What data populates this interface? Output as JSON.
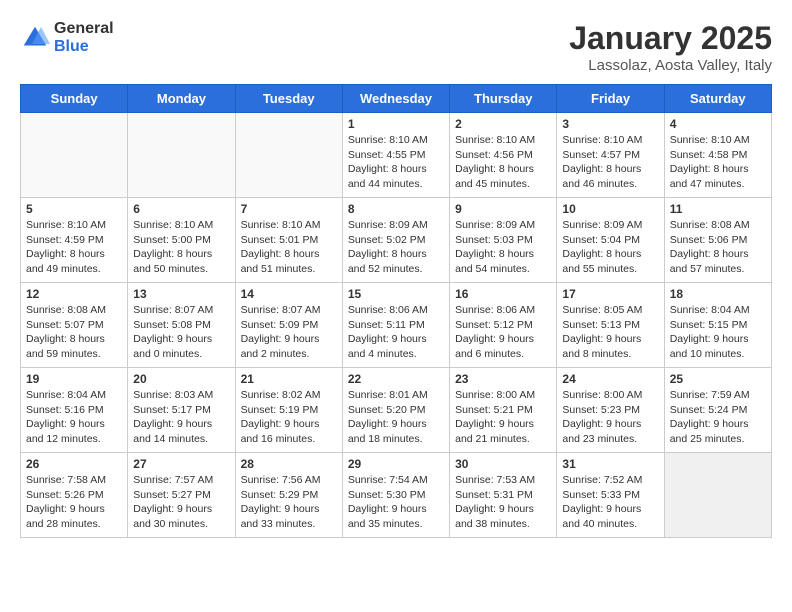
{
  "logo": {
    "general": "General",
    "blue": "Blue"
  },
  "title": "January 2025",
  "subtitle": "Lassolaz, Aosta Valley, Italy",
  "headers": [
    "Sunday",
    "Monday",
    "Tuesday",
    "Wednesday",
    "Thursday",
    "Friday",
    "Saturday"
  ],
  "weeks": [
    [
      {
        "day": "",
        "content": ""
      },
      {
        "day": "",
        "content": ""
      },
      {
        "day": "",
        "content": ""
      },
      {
        "day": "1",
        "content": "Sunrise: 8:10 AM\nSunset: 4:55 PM\nDaylight: 8 hours\nand 44 minutes."
      },
      {
        "day": "2",
        "content": "Sunrise: 8:10 AM\nSunset: 4:56 PM\nDaylight: 8 hours\nand 45 minutes."
      },
      {
        "day": "3",
        "content": "Sunrise: 8:10 AM\nSunset: 4:57 PM\nDaylight: 8 hours\nand 46 minutes."
      },
      {
        "day": "4",
        "content": "Sunrise: 8:10 AM\nSunset: 4:58 PM\nDaylight: 8 hours\nand 47 minutes."
      }
    ],
    [
      {
        "day": "5",
        "content": "Sunrise: 8:10 AM\nSunset: 4:59 PM\nDaylight: 8 hours\nand 49 minutes."
      },
      {
        "day": "6",
        "content": "Sunrise: 8:10 AM\nSunset: 5:00 PM\nDaylight: 8 hours\nand 50 minutes."
      },
      {
        "day": "7",
        "content": "Sunrise: 8:10 AM\nSunset: 5:01 PM\nDaylight: 8 hours\nand 51 minutes."
      },
      {
        "day": "8",
        "content": "Sunrise: 8:09 AM\nSunset: 5:02 PM\nDaylight: 8 hours\nand 52 minutes."
      },
      {
        "day": "9",
        "content": "Sunrise: 8:09 AM\nSunset: 5:03 PM\nDaylight: 8 hours\nand 54 minutes."
      },
      {
        "day": "10",
        "content": "Sunrise: 8:09 AM\nSunset: 5:04 PM\nDaylight: 8 hours\nand 55 minutes."
      },
      {
        "day": "11",
        "content": "Sunrise: 8:08 AM\nSunset: 5:06 PM\nDaylight: 8 hours\nand 57 minutes."
      }
    ],
    [
      {
        "day": "12",
        "content": "Sunrise: 8:08 AM\nSunset: 5:07 PM\nDaylight: 8 hours\nand 59 minutes."
      },
      {
        "day": "13",
        "content": "Sunrise: 8:07 AM\nSunset: 5:08 PM\nDaylight: 9 hours\nand 0 minutes."
      },
      {
        "day": "14",
        "content": "Sunrise: 8:07 AM\nSunset: 5:09 PM\nDaylight: 9 hours\nand 2 minutes."
      },
      {
        "day": "15",
        "content": "Sunrise: 8:06 AM\nSunset: 5:11 PM\nDaylight: 9 hours\nand 4 minutes."
      },
      {
        "day": "16",
        "content": "Sunrise: 8:06 AM\nSunset: 5:12 PM\nDaylight: 9 hours\nand 6 minutes."
      },
      {
        "day": "17",
        "content": "Sunrise: 8:05 AM\nSunset: 5:13 PM\nDaylight: 9 hours\nand 8 minutes."
      },
      {
        "day": "18",
        "content": "Sunrise: 8:04 AM\nSunset: 5:15 PM\nDaylight: 9 hours\nand 10 minutes."
      }
    ],
    [
      {
        "day": "19",
        "content": "Sunrise: 8:04 AM\nSunset: 5:16 PM\nDaylight: 9 hours\nand 12 minutes."
      },
      {
        "day": "20",
        "content": "Sunrise: 8:03 AM\nSunset: 5:17 PM\nDaylight: 9 hours\nand 14 minutes."
      },
      {
        "day": "21",
        "content": "Sunrise: 8:02 AM\nSunset: 5:19 PM\nDaylight: 9 hours\nand 16 minutes."
      },
      {
        "day": "22",
        "content": "Sunrise: 8:01 AM\nSunset: 5:20 PM\nDaylight: 9 hours\nand 18 minutes."
      },
      {
        "day": "23",
        "content": "Sunrise: 8:00 AM\nSunset: 5:21 PM\nDaylight: 9 hours\nand 21 minutes."
      },
      {
        "day": "24",
        "content": "Sunrise: 8:00 AM\nSunset: 5:23 PM\nDaylight: 9 hours\nand 23 minutes."
      },
      {
        "day": "25",
        "content": "Sunrise: 7:59 AM\nSunset: 5:24 PM\nDaylight: 9 hours\nand 25 minutes."
      }
    ],
    [
      {
        "day": "26",
        "content": "Sunrise: 7:58 AM\nSunset: 5:26 PM\nDaylight: 9 hours\nand 28 minutes."
      },
      {
        "day": "27",
        "content": "Sunrise: 7:57 AM\nSunset: 5:27 PM\nDaylight: 9 hours\nand 30 minutes."
      },
      {
        "day": "28",
        "content": "Sunrise: 7:56 AM\nSunset: 5:29 PM\nDaylight: 9 hours\nand 33 minutes."
      },
      {
        "day": "29",
        "content": "Sunrise: 7:54 AM\nSunset: 5:30 PM\nDaylight: 9 hours\nand 35 minutes."
      },
      {
        "day": "30",
        "content": "Sunrise: 7:53 AM\nSunset: 5:31 PM\nDaylight: 9 hours\nand 38 minutes."
      },
      {
        "day": "31",
        "content": "Sunrise: 7:52 AM\nSunset: 5:33 PM\nDaylight: 9 hours\nand 40 minutes."
      },
      {
        "day": "",
        "content": ""
      }
    ]
  ]
}
